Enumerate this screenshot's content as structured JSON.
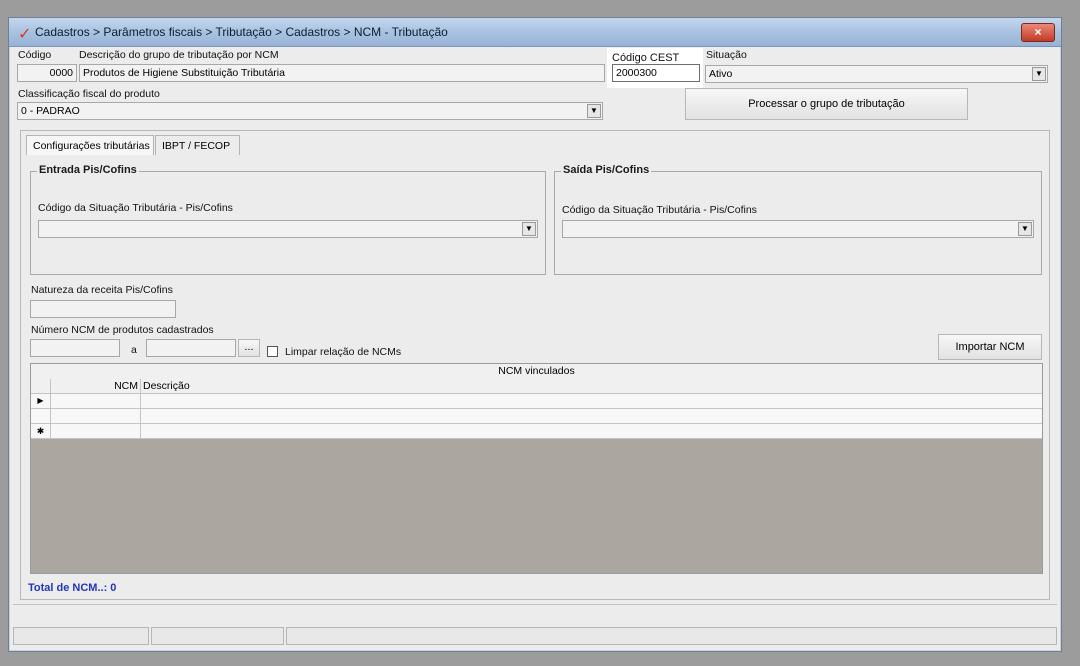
{
  "window": {
    "title": "Cadastros > Parâmetros fiscais > Tributação > Cadastros > NCM - Tributação",
    "close_icon": "×"
  },
  "header": {
    "codigo_label": "Código",
    "codigo_value": "0000",
    "descricao_label": "Descrição do grupo de tributação por NCM",
    "descricao_value": "Produtos de Higiene Substituição Tributária",
    "cest_label": "Código CEST",
    "cest_value": "2000300",
    "situacao_label": "Situação",
    "situacao_value": "Ativo",
    "classificacao_label": "Classificação fiscal do produto",
    "classificacao_value": "0 - PADRAO",
    "processar_button": "Processar o grupo de tributação"
  },
  "tabs": [
    {
      "label": "Configurações tributárias",
      "active": true
    },
    {
      "label": "IBPT / FECOP",
      "active": false
    }
  ],
  "entrada": {
    "title": "Entrada Pis/Cofins",
    "cst_label": "Código da Situação Tributária - Pis/Cofins",
    "cst_value": ""
  },
  "saida": {
    "title": "Saída Pis/Cofins",
    "cst_label": "Código da Situação Tributária - Pis/Cofins",
    "cst_value": ""
  },
  "natureza": {
    "label": "Natureza da receita Pis/Cofins",
    "value": ""
  },
  "ncm_range": {
    "label": "Número  NCM de produtos cadastrados",
    "from_value": "",
    "separator": "a",
    "to_value": "",
    "browse_button": "...",
    "clear_checkbox_label": "Limpar relação de NCMs",
    "clear_checked": false,
    "import_button": "Importar NCM"
  },
  "grid": {
    "caption": "NCM vinculados",
    "columns": [
      "NCM",
      "Descrição"
    ],
    "rows": [
      {
        "indicator": "▶",
        "ncm": "",
        "descricao": ""
      },
      {
        "indicator": "",
        "ncm": "",
        "descricao": ""
      },
      {
        "indicator": "✱",
        "ncm": "",
        "descricao": ""
      }
    ]
  },
  "footer": {
    "total_label": "Total de NCM..: 0"
  },
  "icons": {
    "dropdown": "▼"
  },
  "colors": {
    "total_text": "#2236b8",
    "title_check": "#d83a1e",
    "close_button": "#c43b24"
  }
}
